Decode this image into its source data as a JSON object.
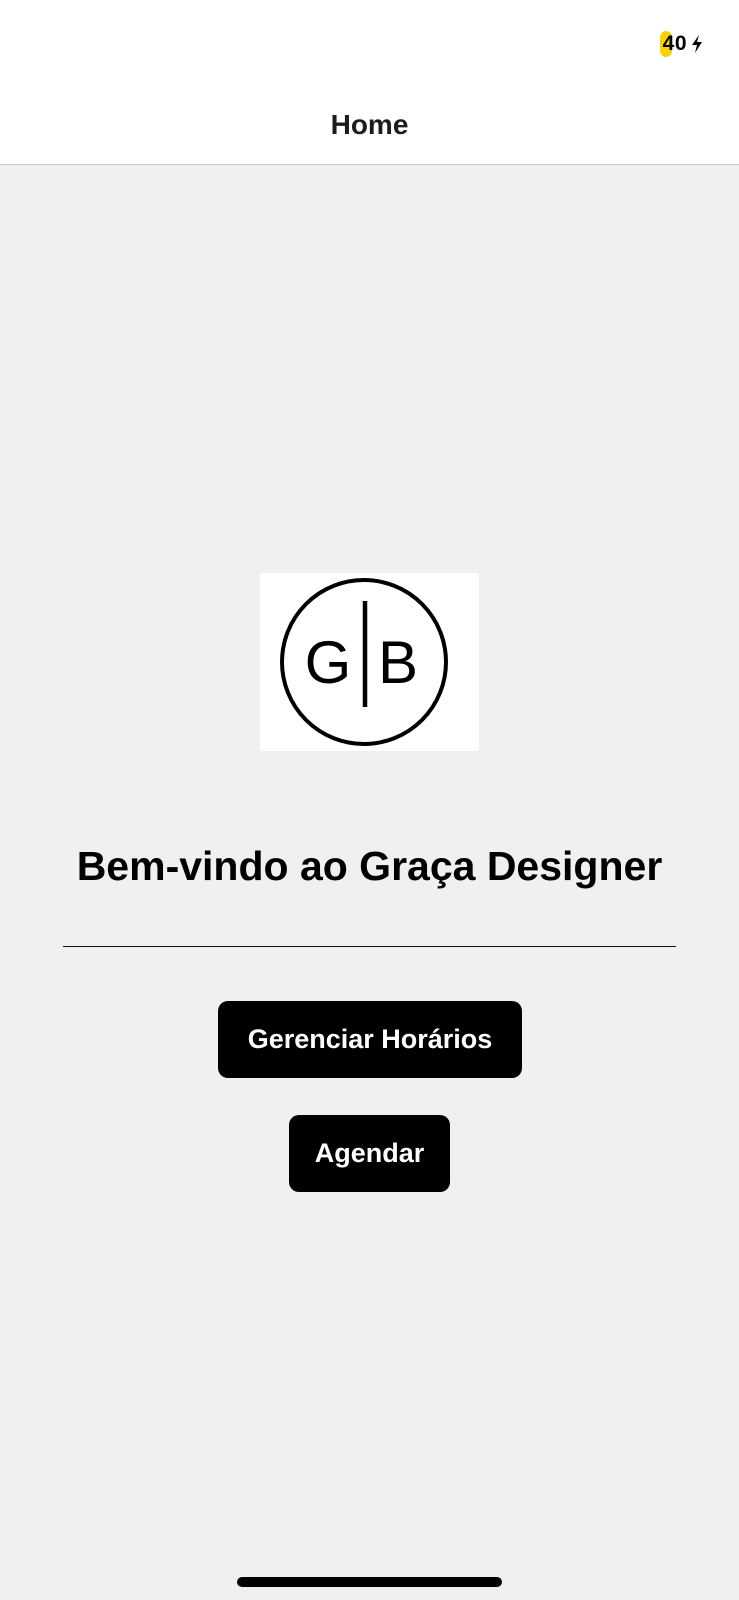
{
  "status_bar": {
    "battery_level": "40",
    "battery_percent": 40,
    "battery_color": "#f5d00b",
    "charging_icon": "bolt-icon"
  },
  "header": {
    "title": "Home"
  },
  "logo": {
    "letter_left": "G",
    "letter_right": "B"
  },
  "main": {
    "welcome_text": "Bem-vindo ao Graça Designer",
    "manage_button_label": "Gerenciar Horários",
    "book_button_label": "Agendar"
  },
  "colors": {
    "background": "#f0f0f0",
    "header_background": "#ffffff",
    "button_background": "#000000",
    "button_text": "#ffffff"
  }
}
